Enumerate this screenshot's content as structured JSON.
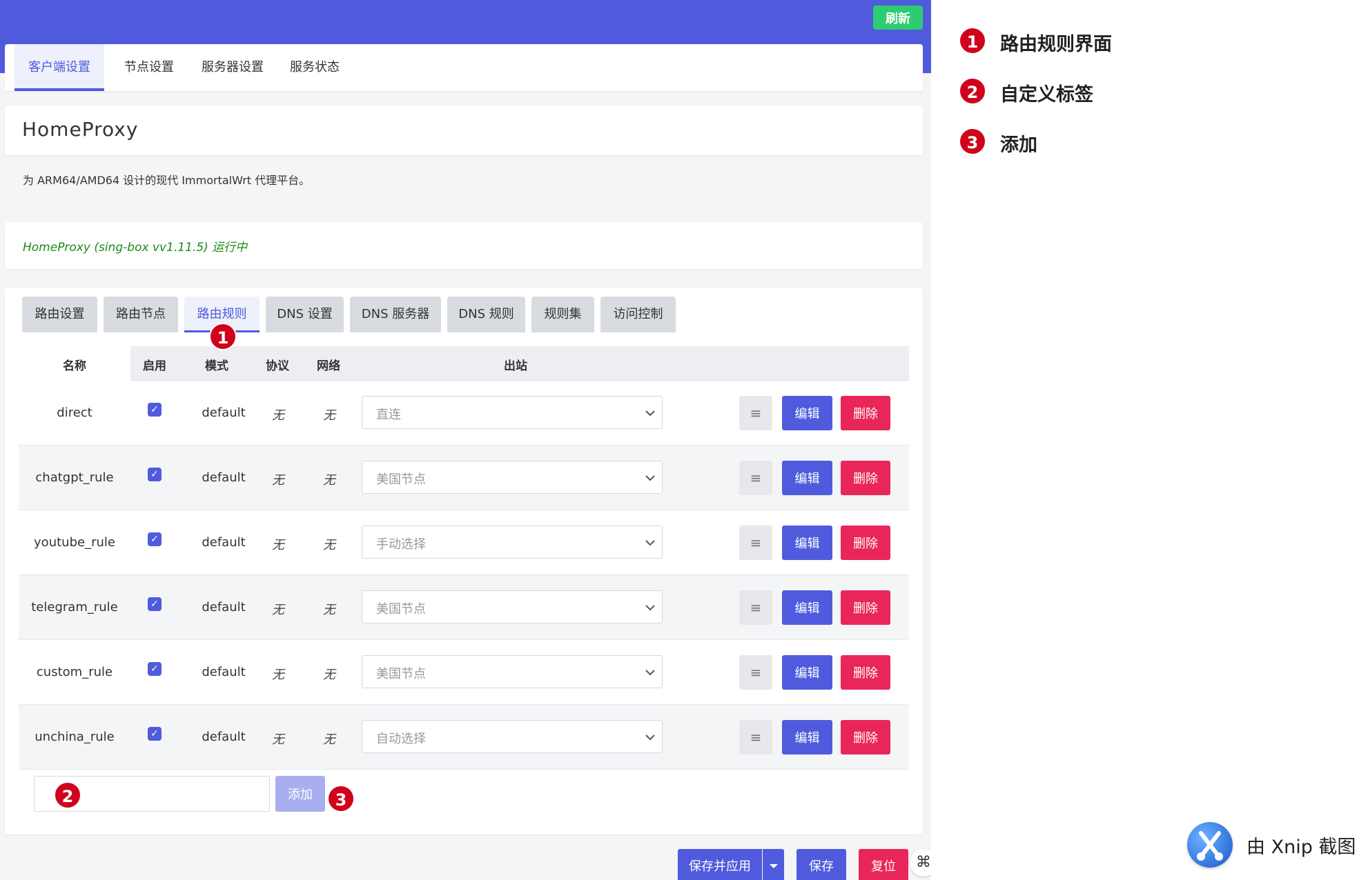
{
  "header": {
    "refresh_label": "刷新"
  },
  "main_tabs": [
    {
      "label": "客户端设置",
      "active": true
    },
    {
      "label": "节点设置",
      "active": false
    },
    {
      "label": "服务器设置",
      "active": false
    },
    {
      "label": "服务状态",
      "active": false
    }
  ],
  "app": {
    "title": "HomeProxy",
    "subtitle": "为 ARM64/AMD64 设计的现代 ImmortalWrt 代理平台。",
    "status": "HomeProxy (sing-box vv1.11.5) 运行中"
  },
  "sub_tabs": [
    {
      "label": "路由设置",
      "active": false
    },
    {
      "label": "路由节点",
      "active": false
    },
    {
      "label": "路由规则",
      "active": true
    },
    {
      "label": "DNS 设置",
      "active": false
    },
    {
      "label": "DNS 服务器",
      "active": false
    },
    {
      "label": "DNS 规则",
      "active": false
    },
    {
      "label": "规则集",
      "active": false
    },
    {
      "label": "访问控制",
      "active": false
    }
  ],
  "table": {
    "headers": {
      "name": "名称",
      "enabled": "启用",
      "mode": "模式",
      "protocol": "协议",
      "network": "网络",
      "outbound": "出站"
    },
    "rows": [
      {
        "name": "direct",
        "enabled": true,
        "mode": "default",
        "protocol": "无",
        "network": "无",
        "outbound": "直连"
      },
      {
        "name": "chatgpt_rule",
        "enabled": true,
        "mode": "default",
        "protocol": "无",
        "network": "无",
        "outbound": "美国节点"
      },
      {
        "name": "youtube_rule",
        "enabled": true,
        "mode": "default",
        "protocol": "无",
        "network": "无",
        "outbound": "手动选择"
      },
      {
        "name": "telegram_rule",
        "enabled": true,
        "mode": "default",
        "protocol": "无",
        "network": "无",
        "outbound": "美国节点"
      },
      {
        "name": "custom_rule",
        "enabled": true,
        "mode": "default",
        "protocol": "无",
        "network": "无",
        "outbound": "美国节点"
      },
      {
        "name": "unchina_rule",
        "enabled": true,
        "mode": "default",
        "protocol": "无",
        "network": "无",
        "outbound": "自动选择"
      }
    ],
    "sort_icon": "≡",
    "edit_label": "编辑",
    "delete_label": "删除"
  },
  "add": {
    "input_value": "",
    "button_label": "添加"
  },
  "footer": {
    "save_apply_label": "保存并应用",
    "save_label": "保存",
    "reset_label": "复位"
  },
  "annotations": [
    {
      "number": "1",
      "label": "路由规则界面"
    },
    {
      "number": "2",
      "label": "自定义标签"
    },
    {
      "number": "3",
      "label": "添加"
    }
  ],
  "watermark": {
    "text": "由 Xnip 截图"
  },
  "colors": {
    "primary": "#4f5bdc",
    "danger": "#e8265a",
    "success": "#2ecc71",
    "marker": "#d0021b"
  }
}
